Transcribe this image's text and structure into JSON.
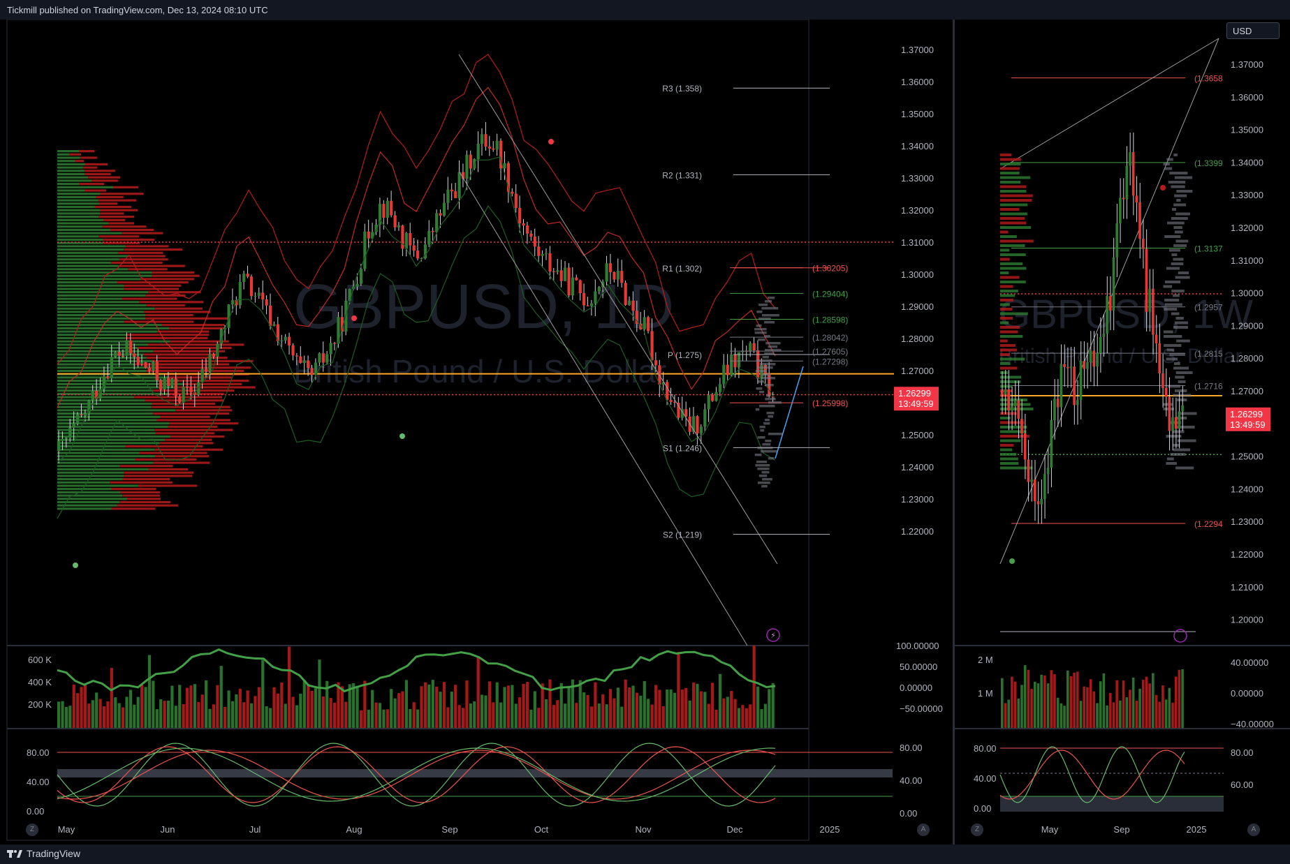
{
  "header": {
    "published": "Tickmill published on TradingView.com, Dec 13, 2024 08:10 UTC"
  },
  "footer": {
    "brand": "TradingView"
  },
  "currency_button": "USD",
  "colors": {
    "up": "#26a69a",
    "down": "#ef5350",
    "green_bar": "#2e7d32",
    "red_bar": "#d32f2f",
    "price": "#f23645",
    "poc": "#ffa726"
  },
  "main_chart": {
    "symbol_watermark": "GBPUSD, 1D",
    "description_watermark": "British Pound / U.S. Dollar",
    "price_axis": [
      "1.37000",
      "1.36000",
      "1.35000",
      "1.34000",
      "1.33000",
      "1.32000",
      "1.31000",
      "1.30000",
      "1.29000",
      "1.28000",
      "1.27000",
      "1.26000",
      "1.25000",
      "1.24000",
      "1.23000",
      "1.22000"
    ],
    "price_axis_bottom": "100.00000",
    "current_price": "1.26299",
    "countdown": "13:49:59",
    "pivots": {
      "r3": "R3 (1.358)",
      "r2": "R2 (1.331)",
      "r1": "R1 (1.302)",
      "p": "P (1.275)",
      "s1": "S1 (1.246)",
      "s2": "S2 (1.219)"
    },
    "levels": [
      "(1.30205)",
      "(1.29404)",
      "(1.28598)",
      "(1.28042)",
      "(1.27605)",
      "(1.27298)",
      "(1.25998)"
    ],
    "time_axis": [
      "May",
      "Jun",
      "Jul",
      "Aug",
      "Sep",
      "Oct",
      "Nov",
      "Dec",
      "2025"
    ]
  },
  "volume_pane": {
    "left_axis": [
      "600 K",
      "400 K",
      "200 K"
    ],
    "right_axis": [
      "50.00000",
      "0.00000",
      "−50.00000"
    ]
  },
  "stoch_pane": {
    "left_axis": [
      "80.00",
      "40.00",
      "0.00"
    ],
    "right_axis": [
      "80.00",
      "40.00",
      "0.00"
    ]
  },
  "side_chart": {
    "symbol_watermark": "GBPUSD, 1W",
    "description_watermark": "British Pound / U.S. Dollar",
    "price_axis": [
      "1.37000",
      "1.36000",
      "1.35000",
      "1.34000",
      "1.33000",
      "1.32000",
      "1.31000",
      "1.30000",
      "1.29000",
      "1.28000",
      "1.27000",
      "1.26000",
      "1.25000",
      "1.24000",
      "1.23000",
      "1.22000",
      "1.21000",
      "1.20000"
    ],
    "current_price": "1.26299",
    "countdown": "13:49:59",
    "levels": [
      "(1.3658",
      "(1.3399",
      "(1.3137",
      "(1.2957",
      "(1.2815",
      "(1.2716",
      "(1.2294"
    ],
    "volume_left_axis": [
      "2 M",
      "1 M"
    ],
    "volume_right_axis": [
      "40.00000",
      "0.00000",
      "−40.00000"
    ],
    "stoch_left_axis": [
      "80.00",
      "40.00",
      "0.00"
    ],
    "stoch_right_axis": [
      "80.00",
      "60.00"
    ],
    "time_axis": [
      "May",
      "Sep",
      "2025"
    ]
  },
  "corner_buttons": {
    "z": "Z",
    "a": "A"
  }
}
